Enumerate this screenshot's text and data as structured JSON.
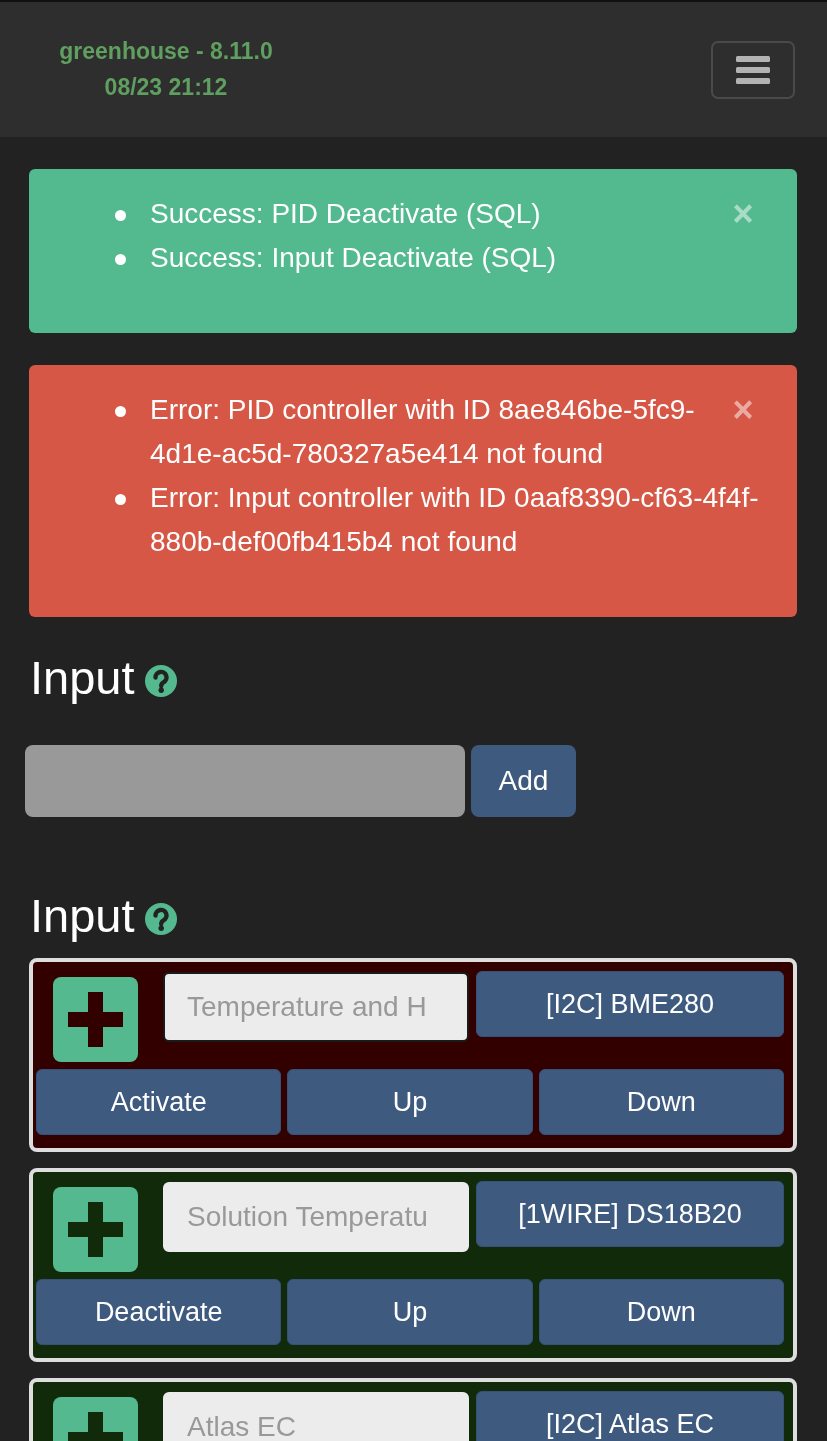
{
  "header": {
    "title": "greenhouse - 8.11.0",
    "datetime": "08/23 21:12"
  },
  "alerts": [
    {
      "kind": "success",
      "close": "×",
      "messages": [
        "Success: PID Deactivate (SQL)",
        "Success: Input Deactivate (SQL)"
      ]
    },
    {
      "kind": "error",
      "close": "×",
      "messages": [
        "Error: PID controller with ID 8ae846be-5fc9-4d1e-ac5d-780327a5e414 not found",
        "Error: Input controller with ID 0aaf8390-cf63-4f4f-880b-def00fb415b4 not found"
      ]
    }
  ],
  "add_section": {
    "heading": "Input",
    "button": "Add"
  },
  "input_section": {
    "heading": "Input",
    "cards": [
      {
        "name": "Temperature and H",
        "active": false,
        "device": "[I2C] BME280",
        "buttons": [
          "Activate",
          "Up",
          "Down"
        ]
      },
      {
        "name": "Solution Temperatu",
        "active": true,
        "device": "[1WIRE] DS18B20",
        "buttons": [
          "Deactivate",
          "Up",
          "Down"
        ]
      },
      {
        "name": "Atlas EC",
        "active": true,
        "device": "[I2C] Atlas EC"
      }
    ]
  }
}
